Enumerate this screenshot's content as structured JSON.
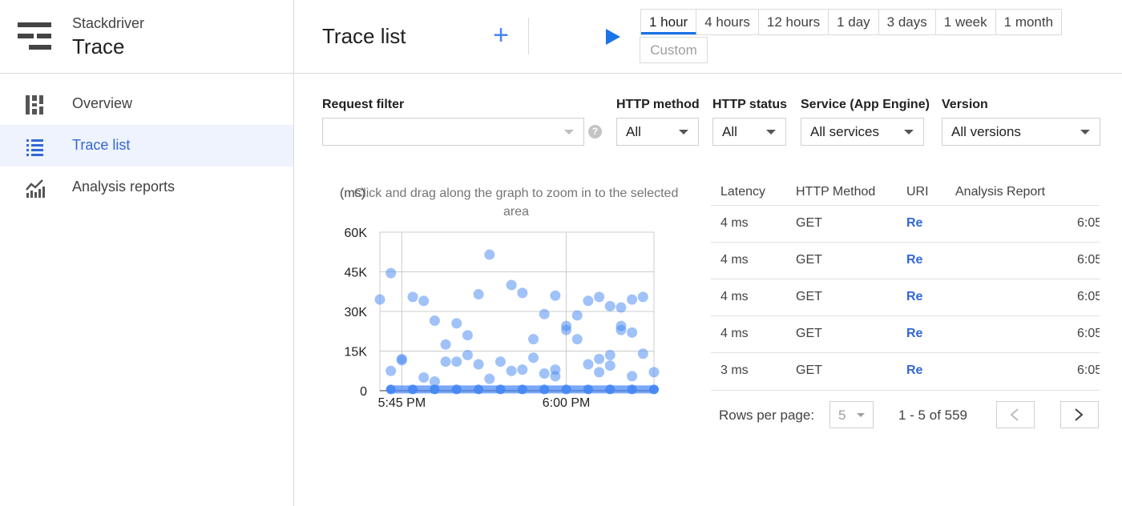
{
  "sidebar": {
    "brand": {
      "top": "Stackdriver",
      "main": "Trace"
    },
    "items": [
      {
        "label": "Overview",
        "icon": "overview-icon"
      },
      {
        "label": "Trace list",
        "icon": "list-icon",
        "active": true
      },
      {
        "label": "Analysis reports",
        "icon": "chart-icon"
      }
    ]
  },
  "header": {
    "title": "Trace list",
    "add_icon": "+",
    "time_ranges": [
      "1 hour",
      "4 hours",
      "12 hours",
      "1 day",
      "3 days",
      "1 week",
      "1 month"
    ],
    "active_range": "1 hour",
    "custom_label": "Custom"
  },
  "filters": {
    "request_filter": {
      "label": "Request filter",
      "value": "",
      "help": "?"
    },
    "http_method": {
      "label": "HTTP method",
      "value": "All"
    },
    "http_status": {
      "label": "HTTP status",
      "value": "All"
    },
    "service": {
      "label": "Service (App Engine)",
      "value": "All services"
    },
    "version": {
      "label": "Version",
      "value": "All versions"
    }
  },
  "chart_data": {
    "type": "scatter",
    "title": "Click and drag along the graph to zoom in to the selected area",
    "ylabel": "(ms)",
    "ylim": [
      0,
      60000
    ],
    "yticks": [
      0,
      15000,
      30000,
      45000,
      60000
    ],
    "ytick_labels": [
      "0",
      "15K",
      "30K",
      "45K",
      "60K"
    ],
    "xlim": [
      "5:43 PM",
      "6:05 PM"
    ],
    "xticks": [
      "5:45 PM",
      "6:00 PM"
    ],
    "grid": true,
    "color": "#4285f4",
    "points": [
      [
        "5:43",
        34500
      ],
      [
        "5:44",
        7500
      ],
      [
        "5:44",
        44500
      ],
      [
        "5:45",
        12000
      ],
      [
        "5:45",
        11500
      ],
      [
        "5:46",
        35500
      ],
      [
        "5:47",
        5000
      ],
      [
        "5:47",
        34000
      ],
      [
        "5:48",
        26500
      ],
      [
        "5:48",
        3500
      ],
      [
        "5:49",
        17500
      ],
      [
        "5:49",
        11000
      ],
      [
        "5:50",
        25500
      ],
      [
        "5:50",
        11000
      ],
      [
        "5:51",
        21000
      ],
      [
        "5:51",
        13500
      ],
      [
        "5:52",
        36500
      ],
      [
        "5:52",
        10000
      ],
      [
        "5:53",
        4500
      ],
      [
        "5:53",
        51500
      ],
      [
        "5:54",
        11000
      ],
      [
        "5:55",
        40000
      ],
      [
        "5:55",
        7500
      ],
      [
        "5:56",
        8000
      ],
      [
        "5:56",
        37000
      ],
      [
        "5:57",
        12500
      ],
      [
        "5:57",
        19500
      ],
      [
        "5:58",
        6500
      ],
      [
        "5:58",
        29000
      ],
      [
        "5:59",
        5500
      ],
      [
        "5:59",
        36000
      ],
      [
        "5:59",
        8000
      ],
      [
        "6:00",
        23000
      ],
      [
        "6:00",
        24500
      ],
      [
        "6:01",
        28500
      ],
      [
        "6:01",
        19500
      ],
      [
        "6:02",
        34000
      ],
      [
        "6:02",
        10000
      ],
      [
        "6:03",
        35500
      ],
      [
        "6:03",
        12000
      ],
      [
        "6:03",
        7000
      ],
      [
        "6:04",
        9500
      ],
      [
        "6:04",
        13500
      ],
      [
        "6:04",
        32000
      ],
      [
        "6:05",
        23000
      ],
      [
        "6:05",
        31500
      ],
      [
        "6:05",
        24500
      ],
      [
        "6:06",
        5500
      ],
      [
        "6:06",
        34500
      ],
      [
        "6:06",
        22000
      ],
      [
        "6:07",
        35500
      ],
      [
        "6:07",
        14000
      ],
      [
        "6:08",
        7000
      ],
      [
        "5:44",
        500
      ],
      [
        "5:46",
        500
      ],
      [
        "5:48",
        500
      ],
      [
        "5:50",
        500
      ],
      [
        "5:52",
        500
      ],
      [
        "5:54",
        500
      ],
      [
        "5:56",
        500
      ],
      [
        "5:58",
        500
      ],
      [
        "6:00",
        500
      ],
      [
        "6:02",
        500
      ],
      [
        "6:04",
        500
      ],
      [
        "6:06",
        500
      ],
      [
        "6:08",
        500
      ]
    ]
  },
  "table": {
    "columns": [
      "Latency",
      "HTTP Method",
      "URI",
      "Analysis Report"
    ],
    "rows": [
      {
        "latency": "4 ms",
        "method": "GET",
        "uri": "Re",
        "time": "6:05"
      },
      {
        "latency": "4 ms",
        "method": "GET",
        "uri": "Re",
        "time": "6:05"
      },
      {
        "latency": "4 ms",
        "method": "GET",
        "uri": "Re",
        "time": "6:05"
      },
      {
        "latency": "4 ms",
        "method": "GET",
        "uri": "Re",
        "time": "6:05"
      },
      {
        "latency": "3 ms",
        "method": "GET",
        "uri": "Re",
        "time": "6:05"
      }
    ]
  },
  "pagination": {
    "rows_per_page_label": "Rows per page:",
    "rows_per_page": "5",
    "range_text": "1 - 5 of 559"
  }
}
